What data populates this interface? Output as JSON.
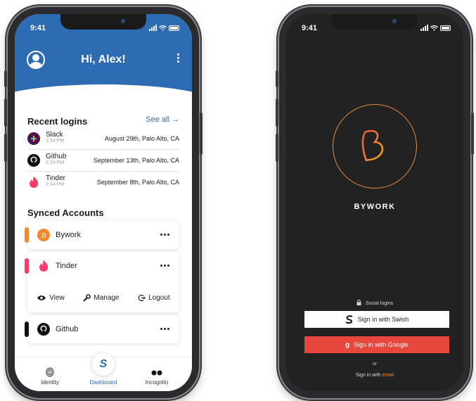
{
  "colors": {
    "primary_blue": "#2d6bb3",
    "google_red": "#e8453c",
    "bywork_orange": "#e98a3a",
    "dark_bg": "#222222"
  },
  "left_phone": {
    "status": {
      "time": "9:41"
    },
    "header": {
      "greeting": "Hi, Alex!"
    },
    "recent_logins": {
      "title": "Recent logins",
      "see_all": "See all →",
      "items": [
        {
          "name": "Slack",
          "time": "2:34 PM",
          "location": "August 29th, Palo Alto, CA",
          "icon": "slack-icon"
        },
        {
          "name": "Github",
          "time": "2:34 PM",
          "location": "September 13th, Palo Alto, CA",
          "icon": "github-icon"
        },
        {
          "name": "Tinder",
          "time": "2:34 PM",
          "location": "September 8th, Palo Alto, CA",
          "icon": "tinder-icon"
        }
      ]
    },
    "synced_accounts": {
      "title": "Synced Accounts",
      "items": [
        {
          "name": "Bywork",
          "icon": "bywork-icon"
        },
        {
          "name": "Tinder",
          "icon": "tinder-icon"
        },
        {
          "name": "Github",
          "icon": "github-icon"
        }
      ],
      "actions": {
        "view": "View",
        "manage": "Manage",
        "logout": "Logout"
      }
    },
    "tabbar": {
      "identity": "Identity",
      "dashboard": "Dashboard",
      "incognito": "Incognito",
      "fab_letter": "S"
    }
  },
  "right_phone": {
    "status": {
      "time": "9:41"
    },
    "brand": "BYWORK",
    "social_label": "Social logins",
    "swish_button": "Sign in with Swish",
    "google_button": "Sign in with Google",
    "or": "or",
    "email_prefix": "Sign in with",
    "email_link": "email"
  }
}
